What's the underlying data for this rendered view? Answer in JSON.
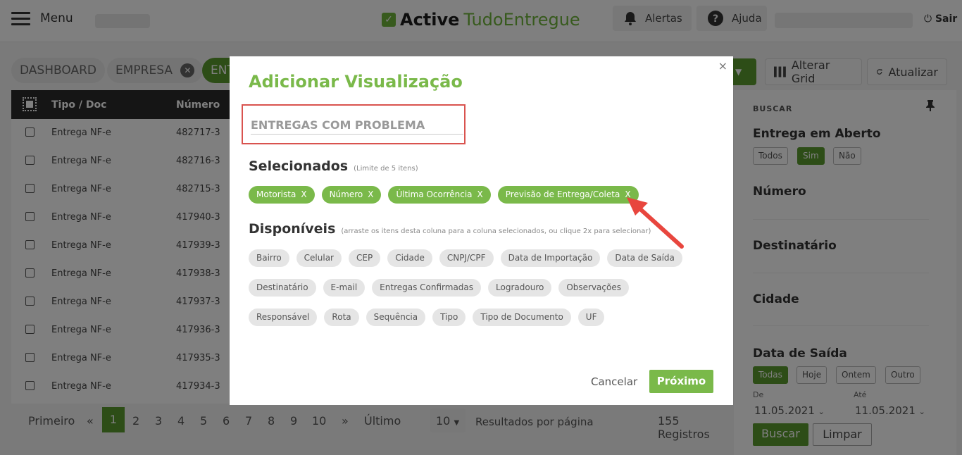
{
  "header": {
    "menu_label": "Menu",
    "brand_part1": "Active",
    "brand_part2": "TudoEntregue",
    "alerts_label": "Alertas",
    "help_label": "Ajuda",
    "logout_label": "Sair"
  },
  "tabs": [
    {
      "label": "DASHBOARD"
    },
    {
      "label": "EMPRESA"
    },
    {
      "label": "ENT"
    }
  ],
  "toolbar": {
    "change_grid_label": "Alterar Grid",
    "refresh_label": "Atualizar"
  },
  "table": {
    "columns": [
      "Tipo / Doc",
      "Número"
    ],
    "rows": [
      {
        "tipo": "Entrega NF-e",
        "numero": "482717-3"
      },
      {
        "tipo": "Entrega NF-e",
        "numero": "482716-3"
      },
      {
        "tipo": "Entrega NF-e",
        "numero": "482715-3"
      },
      {
        "tipo": "Entrega NF-e",
        "numero": "417940-3"
      },
      {
        "tipo": "Entrega NF-e",
        "numero": "417939-3"
      },
      {
        "tipo": "Entrega NF-e",
        "numero": "417938-3"
      },
      {
        "tipo": "Entrega NF-e",
        "numero": "417937-3"
      },
      {
        "tipo": "Entrega NF-e",
        "numero": "417936-3"
      },
      {
        "tipo": "Entrega NF-e",
        "numero": "417935-3"
      },
      {
        "tipo": "Entrega NF-e",
        "numero": "417934-3"
      }
    ]
  },
  "pagination": {
    "first": "Primeiro",
    "prev": "«",
    "pages": [
      "1",
      "2",
      "3",
      "4",
      "5",
      "6",
      "7",
      "8",
      "9",
      "10"
    ],
    "next": "»",
    "last": "Último",
    "per_page": "10",
    "per_page_label": "Resultados por página",
    "total": "155 Registros"
  },
  "side": {
    "title": "BUSCAR",
    "open_delivery": "Entrega em Aberto",
    "opt_all": "Todos",
    "opt_yes": "Sim",
    "opt_no": "Não",
    "number": "Número",
    "recipient": "Destinatário",
    "city": "Cidade",
    "exit_date": "Data de Saída",
    "d_all": "Todas",
    "d_today": "Hoje",
    "d_yesterday": "Ontem",
    "d_other": "Outro",
    "from_label": "De",
    "to_label": "Até",
    "from_date": "11.05.2021",
    "to_date": "11.05.2021",
    "search_btn": "Buscar",
    "clear_btn": "Limpar"
  },
  "modal": {
    "close": "×",
    "title": "Adicionar Visualização",
    "name_placeholder": "ENTREGAS COM PROBLEMA",
    "selected_title": "Selecionados",
    "selected_note": "(Limite de 5 itens)",
    "selected": [
      {
        "label": "Motorista",
        "x": "X"
      },
      {
        "label": "Número",
        "x": "X"
      },
      {
        "label": "Última Ocorrência",
        "x": "X"
      },
      {
        "label": "Previsão de Entrega/Coleta",
        "x": "X"
      }
    ],
    "available_title": "Disponíveis",
    "available_note": "(arraste os itens desta coluna para a coluna selecionados, ou clique 2x para selecionar)",
    "available": [
      "Bairro",
      "Celular",
      "CEP",
      "Cidade",
      "CNPJ/CPF",
      "Data de Importação",
      "Data de Saída",
      "Destinatário",
      "E-mail",
      "Entregas Confirmadas",
      "Logradouro",
      "Observações",
      "Responsável",
      "Rota",
      "Sequência",
      "Tipo",
      "Tipo de Documento",
      "UF"
    ],
    "cancel": "Cancelar",
    "next": "Próximo"
  },
  "colors": {
    "brand_green": "#6fb43a",
    "accent_green": "#7ab94a",
    "highlight_red": "#d9534f"
  },
  "icons": [
    "menu-icon",
    "bell-icon",
    "help-icon",
    "power-icon",
    "grid-icon",
    "refresh-icon",
    "pin-icon",
    "close-icon",
    "chevron-down-icon"
  ]
}
